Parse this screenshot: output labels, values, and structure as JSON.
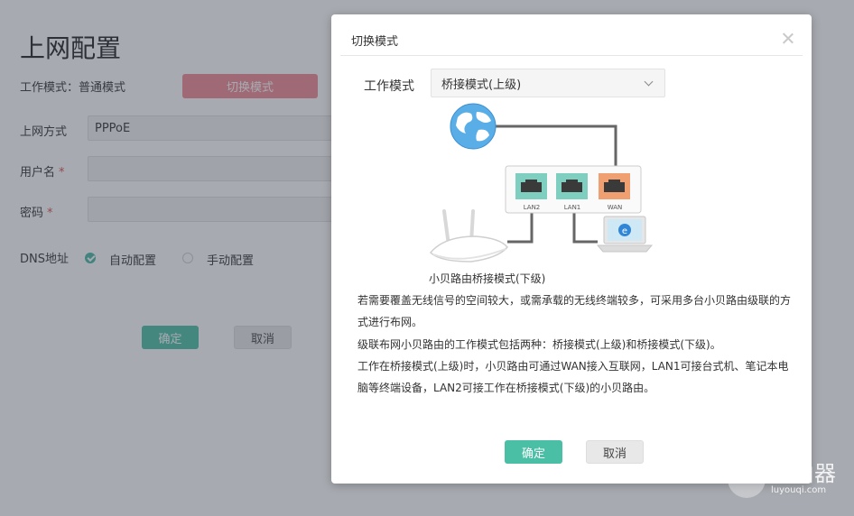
{
  "background": {
    "title": "上网配置",
    "work_mode_label": "工作模式：普通模式",
    "switch_mode_button": "切换模式",
    "connection_label": "上网方式",
    "connection_value": "PPPoE",
    "username_label": "用户名",
    "password_label": "密码",
    "required_mark": "*",
    "dns_label": "DNS地址",
    "dns_auto": "自动配置",
    "dns_manual": "手动配置",
    "confirm": "确定",
    "cancel": "取消"
  },
  "modal": {
    "title": "切换模式",
    "mode_label": "工作模式",
    "mode_value": "桥接模式(上级)",
    "diagram": {
      "ports": [
        "LAN2",
        "LAN1",
        "WAN"
      ],
      "caption": "小贝路由桥接模式(下级)"
    },
    "paragraphs": [
      "若需要覆盖无线信号的空间较大，或需承载的无线终端较多，可采用多台小贝路由级联的方式进行布网。",
      "级联布网小贝路由的工作模式包括两种：桥接模式(上级)和桥接模式(下级)。",
      "工作在桥接模式(上级)时，小贝路由可通过WAN接入互联网，LAN1可接台式机、笔记本电脑等终端设备，LAN2可接工作在桥接模式(下级)的小贝路由。"
    ],
    "confirm": "确定",
    "cancel": "取消"
  },
  "watermark": {
    "main": "路由器",
    "sub": "luyouqi.com"
  },
  "colors": {
    "accent": "#4bbfa6",
    "switch_button": "#f08a96",
    "wan_port": "#f0a070",
    "lan_port": "#7fcfc0"
  }
}
